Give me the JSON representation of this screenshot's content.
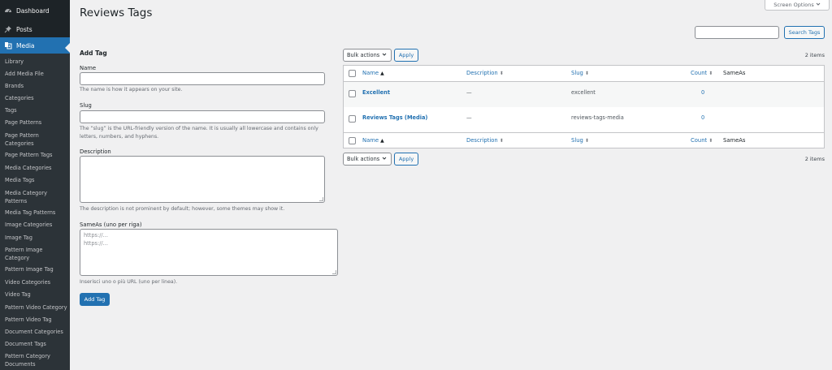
{
  "sidebar": {
    "top_items": [
      {
        "label": "Dashboard",
        "icon": "dashboard-icon"
      },
      {
        "label": "Posts",
        "icon": "pin-icon"
      },
      {
        "label": "Media",
        "icon": "media-icon",
        "current": true
      }
    ],
    "submenu": [
      "Library",
      "Add Media File",
      "Brands",
      "Categories",
      "Tags",
      "Page Patterns",
      "Page Pattern Categories",
      "Page Pattern Tags",
      "Media Categories",
      "Media Tags",
      "Media Category Patterns",
      "Media Tag Patterns",
      "Image Categories",
      "Image Tag",
      "Pattern Image Category",
      "Pattern Image Tag",
      "Video Categories",
      "Video Tag",
      "Pattern Video Category",
      "Pattern Video Tag",
      "Document Categories",
      "Document Tags",
      "Pattern Category Documents"
    ]
  },
  "header": {
    "title": "Reviews Tags",
    "screen_options": "Screen Options",
    "search_button": "Search Tags"
  },
  "form": {
    "heading": "Add Tag",
    "name_label": "Name",
    "name_hint": "The name is how it appears on your site.",
    "slug_label": "Slug",
    "slug_hint": "The “slug” is the URL-friendly version of the name. It is usually all lowercase and contains only letters, numbers, and hyphens.",
    "description_label": "Description",
    "description_hint": "The description is not prominent by default; however, some themes may show it.",
    "sameas_label": "SameAs (uno per riga)",
    "sameas_lines": [
      "https://...",
      "https://..."
    ],
    "sameas_hint": "Inserisci uno o più URL (uno per linea).",
    "submit": "Add Tag"
  },
  "table": {
    "bulk_actions": "Bulk actions",
    "apply": "Apply",
    "item_count": "2 items",
    "columns": {
      "name": "Name",
      "description": "Description",
      "slug": "Slug",
      "count": "Count",
      "sameas": "SameAs"
    },
    "rows": [
      {
        "name": "Excellent",
        "description": "—",
        "slug": "excellent",
        "count": "0"
      },
      {
        "name": "Reviews Tags (Media)",
        "description": "—",
        "slug": "reviews-tags-media",
        "count": "0"
      }
    ]
  },
  "colors": {
    "accent": "#2271b1",
    "sidebar_bg": "#1d2327",
    "page_bg": "#f0f0f1"
  }
}
